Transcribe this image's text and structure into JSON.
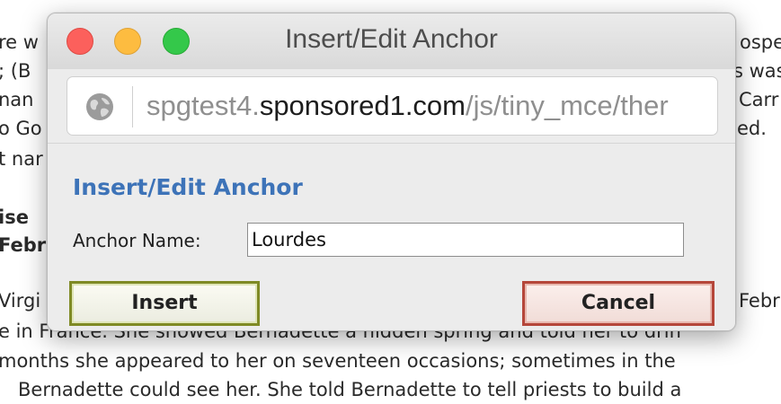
{
  "background_text": {
    "lines_left": [
      "re w",
      "; (B",
      "nan",
      "o Go",
      "t nar",
      "ise",
      "Febr",
      "Virgi",
      "e in France. She showed Bernadette a hidden spring and told her to drin",
      "months she appeared to her on seventeen occasions; sometimes in the",
      "Bernadette could see her. She told Bernadette to tell priests to build a"
    ],
    "lines_right": [
      "ospel",
      "s was",
      "Carr",
      "ed.",
      "Febru"
    ]
  },
  "window": {
    "title": "Insert/Edit Anchor",
    "url_prefix": "spgtest4.",
    "url_host": "sponsored1.com",
    "url_path": "/js/tiny_mce/ther"
  },
  "dialog": {
    "heading": "Insert/Edit Anchor",
    "anchor_label": "Anchor Name:",
    "anchor_value": "Lourdes",
    "insert_label": "Insert",
    "cancel_label": "Cancel"
  },
  "colors": {
    "heading": "#3d73b8",
    "insert_border": "#7f8a25",
    "cancel_border": "#b5463a",
    "close_button": "#fc605c",
    "minimize_button": "#fdbc40",
    "zoom_button": "#34c84a"
  },
  "icons": [
    "globe-icon"
  ]
}
